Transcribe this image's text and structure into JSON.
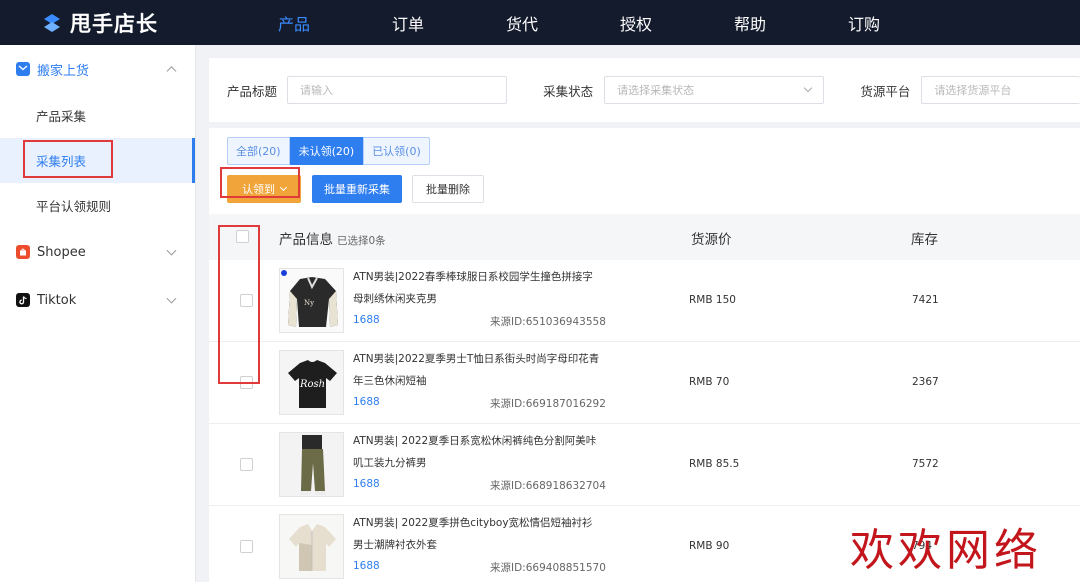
{
  "brand": {
    "name": "甩手店长",
    "icon": "brand-s-icon"
  },
  "nav": {
    "items": [
      {
        "label": "产品",
        "active": true
      },
      {
        "label": "订单"
      },
      {
        "label": "货代"
      },
      {
        "label": "授权"
      },
      {
        "label": "帮助"
      },
      {
        "label": "订购"
      }
    ]
  },
  "sidebar": {
    "groups": [
      {
        "label": "搬家上货",
        "icon": "mail-icon",
        "color": "#2f7ef0",
        "open": true,
        "items": [
          {
            "label": "产品采集"
          },
          {
            "label": "采集列表",
            "active": true
          },
          {
            "label": "平台认领规则"
          }
        ]
      },
      {
        "label": "Shopee",
        "icon": "shopee-bag-icon",
        "color": "#ee4d2d"
      },
      {
        "label": "Tiktok",
        "icon": "tiktok-icon",
        "color": "#111111"
      }
    ]
  },
  "filters": {
    "title_label": "产品标题",
    "title_placeholder": "请输入",
    "status_label": "采集状态",
    "status_placeholder": "请选择采集状态",
    "platform_label": "货源平台",
    "platform_placeholder": "请选择货源平台"
  },
  "tabs": [
    {
      "label": "全部(20)"
    },
    {
      "label": "未认领(20)",
      "active": true
    },
    {
      "label": "已认领(0)"
    }
  ],
  "actions": {
    "claim": "认领到",
    "recollect": "批量重新采集",
    "delete": "批量删除"
  },
  "table": {
    "col_product": "产品信息",
    "selected_note": "已选择0条",
    "col_price": "货源价",
    "col_stock": "库存",
    "rows": [
      {
        "title": "ATN男装|2022春季棒球服日系校园学生撞色拼接字母刺绣休闲夹克男",
        "source": "1688",
        "source_id": "来源ID:651036943558",
        "price": "RMB 150",
        "stock": "7421"
      },
      {
        "title": "ATN男装|2022夏季男士T恤日系街头时尚字母印花青年三色休闲短袖",
        "source": "1688",
        "source_id": "来源ID:669187016292",
        "price": "RMB 70",
        "stock": "2367"
      },
      {
        "title": "ATN男装| 2022夏季日系宽松休闲裤纯色分割阿美咔叽工装九分裤男",
        "source": "1688",
        "source_id": "来源ID:668918632704",
        "price": "RMB 85.5",
        "stock": "7572"
      },
      {
        "title": "ATN男装| 2022夏季拼色cityboy宽松情侣短袖衬衫男士潮牌衬衣外套",
        "source": "1688",
        "source_id": "来源ID:669408851570",
        "price": "RMB 90",
        "stock": "794"
      }
    ]
  },
  "watermark": "欢欢网络"
}
